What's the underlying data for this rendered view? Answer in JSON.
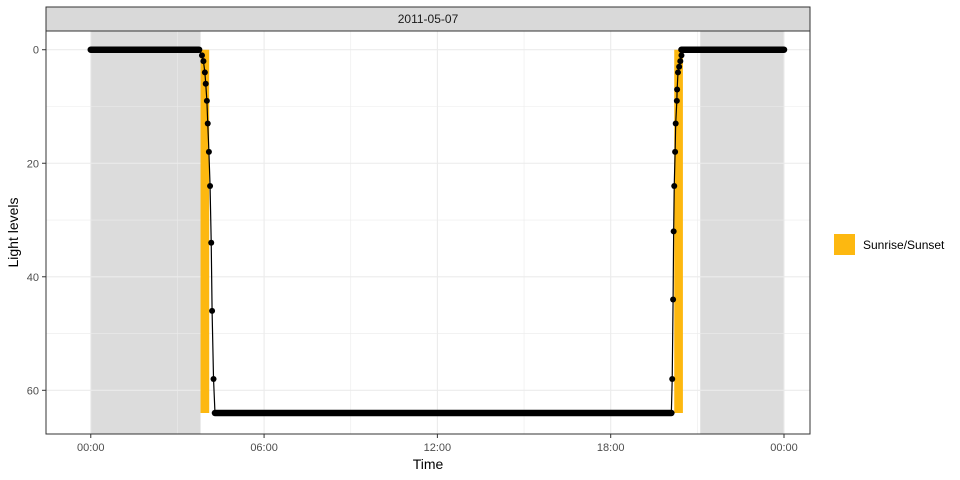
{
  "chart_data": {
    "type": "line",
    "facet_label": "2011-05-07",
    "xlabel": "Time",
    "ylabel": "Light levels",
    "x_unit": "hours",
    "xlim": [
      -1.55,
      24.9
    ],
    "ylim": [
      67.7,
      -3.3
    ],
    "y_reversed": true,
    "x_ticks": [
      {
        "value": 0,
        "label": "00:00"
      },
      {
        "value": 6,
        "label": "06:00"
      },
      {
        "value": 12,
        "label": "12:00"
      },
      {
        "value": 18,
        "label": "18:00"
      },
      {
        "value": 24,
        "label": "00:00"
      }
    ],
    "y_ticks": [
      0,
      20,
      40,
      60
    ],
    "grid": true,
    "night_shading": [
      [
        0,
        3.8
      ],
      [
        21.1,
        24
      ]
    ],
    "sunrise_sunset_bands": [
      [
        3.8,
        4.1
      ],
      [
        20.2,
        20.5
      ]
    ],
    "legend": {
      "position": "right",
      "entries": [
        {
          "label": "Sunrise/Sunset",
          "color": "#FDB810"
        }
      ]
    },
    "series": [
      {
        "color": "#000000",
        "flat_segments": [
          {
            "x_start": 0,
            "x_end": 3.75,
            "y": 0
          },
          {
            "x_start": 4.3,
            "x_end": 20.1,
            "y": 64
          },
          {
            "x_start": 20.45,
            "x_end": 24,
            "y": 0
          }
        ],
        "points": [
          [
            3.85,
            1
          ],
          [
            3.9,
            2
          ],
          [
            3.95,
            4
          ],
          [
            3.98,
            6
          ],
          [
            4.02,
            9
          ],
          [
            4.05,
            13
          ],
          [
            4.09,
            18
          ],
          [
            4.13,
            24
          ],
          [
            4.17,
            34
          ],
          [
            4.2,
            46
          ],
          [
            4.25,
            58
          ],
          [
            4.3,
            64
          ],
          [
            20.1,
            64
          ],
          [
            20.13,
            58
          ],
          [
            20.16,
            44
          ],
          [
            20.18,
            32
          ],
          [
            20.2,
            24
          ],
          [
            20.23,
            18
          ],
          [
            20.25,
            13
          ],
          [
            20.29,
            9
          ],
          [
            20.3,
            7
          ],
          [
            20.33,
            4
          ],
          [
            20.37,
            3
          ],
          [
            20.41,
            2
          ],
          [
            20.45,
            1
          ],
          [
            20.5,
            0
          ]
        ]
      }
    ]
  },
  "colors": {
    "night": "#DCDCDC",
    "sunrise_sunset": "#FDB810",
    "line": "#000000",
    "grid": "#EBEBEB",
    "strip_bg": "#D9D9D9",
    "panel_border": "#333333"
  }
}
